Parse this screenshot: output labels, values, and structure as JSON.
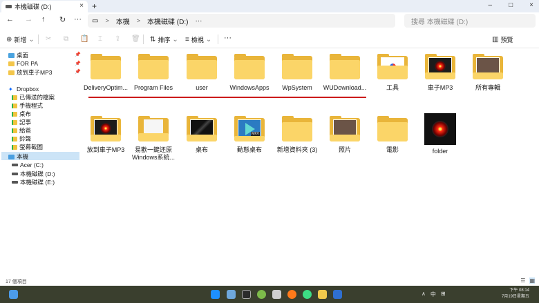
{
  "window": {
    "tab_title": "本機磁碟 (D:)",
    "tab_close": "×",
    "tab_add": "+",
    "controls": [
      "–",
      "□",
      "×"
    ]
  },
  "nav": {
    "back": "←",
    "forward": "→",
    "up": "↑",
    "refresh": "↻",
    "more": "···"
  },
  "address": {
    "monitor_icon": "▭",
    "crumbs": [
      "本機",
      "本機磁碟 (D:)"
    ],
    "separators": [
      ">",
      ">"
    ],
    "more": "···"
  },
  "search": {
    "placeholder": "搜尋 本機磁碟 (D:)"
  },
  "toolbar": {
    "new_label": "新增",
    "sort_label": "排序",
    "view_label": "檢視",
    "more": "···",
    "preview_label": "預覽"
  },
  "sidebar": {
    "pinned": [
      {
        "label": "桌面"
      },
      {
        "label": "FOR PA"
      },
      {
        "label": "放到車子MP3"
      }
    ],
    "dropbox": {
      "label": "Dropbox",
      "children": [
        "已傳送的檔案",
        "手機程式",
        "桌布",
        "記事",
        "給爸",
        "鈴聲",
        "螢幕截圖"
      ]
    },
    "this_pc": {
      "label": "本機",
      "drives": [
        "Acer (C:)",
        "本機磁碟 (D:)",
        "本機磁碟 (E:)"
      ]
    }
  },
  "items_row1": [
    {
      "name": "DeliveryOptim...",
      "kind": "folder"
    },
    {
      "name": "Program Files",
      "kind": "folder"
    },
    {
      "name": "user",
      "kind": "folder"
    },
    {
      "name": "WindowsApps",
      "kind": "folder"
    },
    {
      "name": "WpSystem",
      "kind": "folder"
    },
    {
      "name": "WUDownload...",
      "kind": "folder"
    },
    {
      "name": "工具",
      "kind": "folder-app"
    },
    {
      "name": "車子MP3",
      "kind": "folder-hal"
    },
    {
      "name": "所有專輯",
      "kind": "folder-people"
    }
  ],
  "items_row2": [
    {
      "name": "放到車子MP3",
      "kind": "folder-hal"
    },
    {
      "name": "易歡一鍵还原\nWindows系統...",
      "kind": "folder-paper"
    },
    {
      "name": "桌布",
      "kind": "folder-video"
    },
    {
      "name": "動態桌布",
      "kind": "folder-mkv"
    },
    {
      "name": "新增資料夾 (3)",
      "kind": "folder"
    },
    {
      "name": "照片",
      "kind": "folder-people"
    },
    {
      "name": "電影",
      "kind": "folder"
    },
    {
      "name": "folder",
      "kind": "image-hal"
    }
  ],
  "mkv_tag": "MKV",
  "status": {
    "count": "17 個項目"
  },
  "taskbar": {
    "tray": [
      "∧",
      "中",
      "⊞"
    ],
    "clock_time": "下午 08:14",
    "clock_date": "7月19日星期五"
  },
  "colors": {
    "accent_blue": "#0067c0",
    "folder_yellow": "#fbd568",
    "annotation_red": "#cc1b1b",
    "selection": "#cce4f7"
  }
}
